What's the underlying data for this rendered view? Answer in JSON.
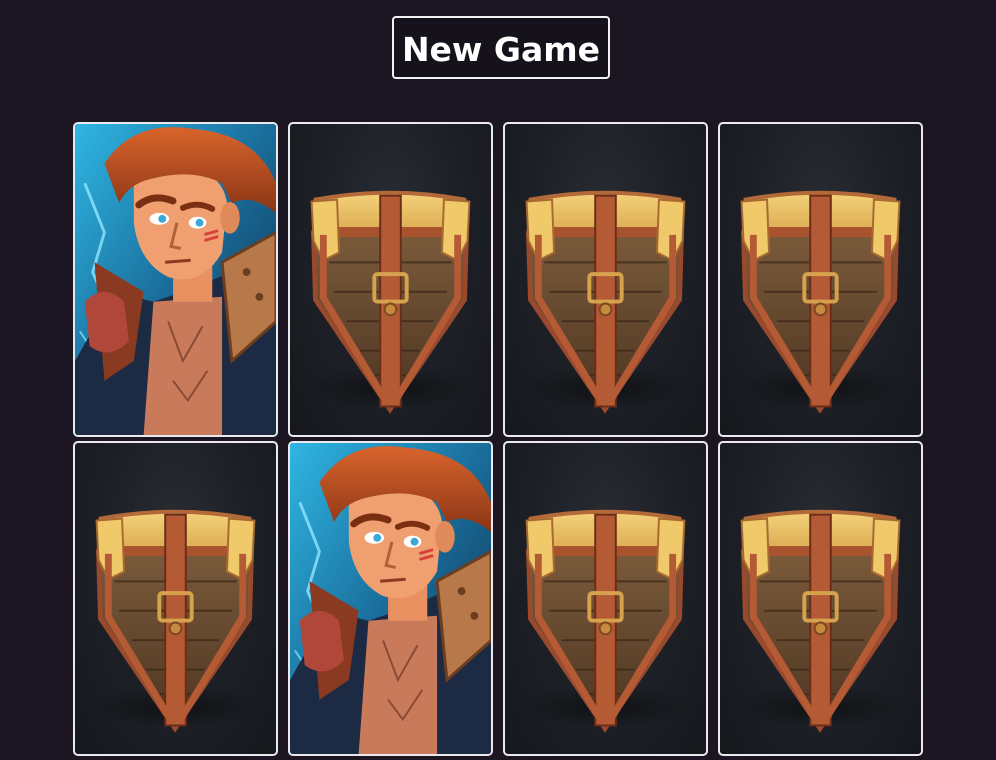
{
  "header": {
    "new_game_label": "New Game"
  },
  "board": {
    "rows": 2,
    "columns": 4,
    "cards": [
      {
        "state": "face-up",
        "picture": "adventurer-portrait-icon"
      },
      {
        "state": "face-down",
        "picture": "treasure-chest-icon"
      },
      {
        "state": "face-down",
        "picture": "treasure-chest-icon"
      },
      {
        "state": "face-down",
        "picture": "treasure-chest-icon"
      },
      {
        "state": "face-down",
        "picture": "treasure-chest-icon"
      },
      {
        "state": "face-up",
        "picture": "adventurer-portrait-icon"
      },
      {
        "state": "face-down",
        "picture": "treasure-chest-icon"
      },
      {
        "state": "face-down",
        "picture": "treasure-chest-icon"
      }
    ]
  },
  "colors": {
    "background": "#1b1622",
    "card_border": "#e9e9ee"
  }
}
